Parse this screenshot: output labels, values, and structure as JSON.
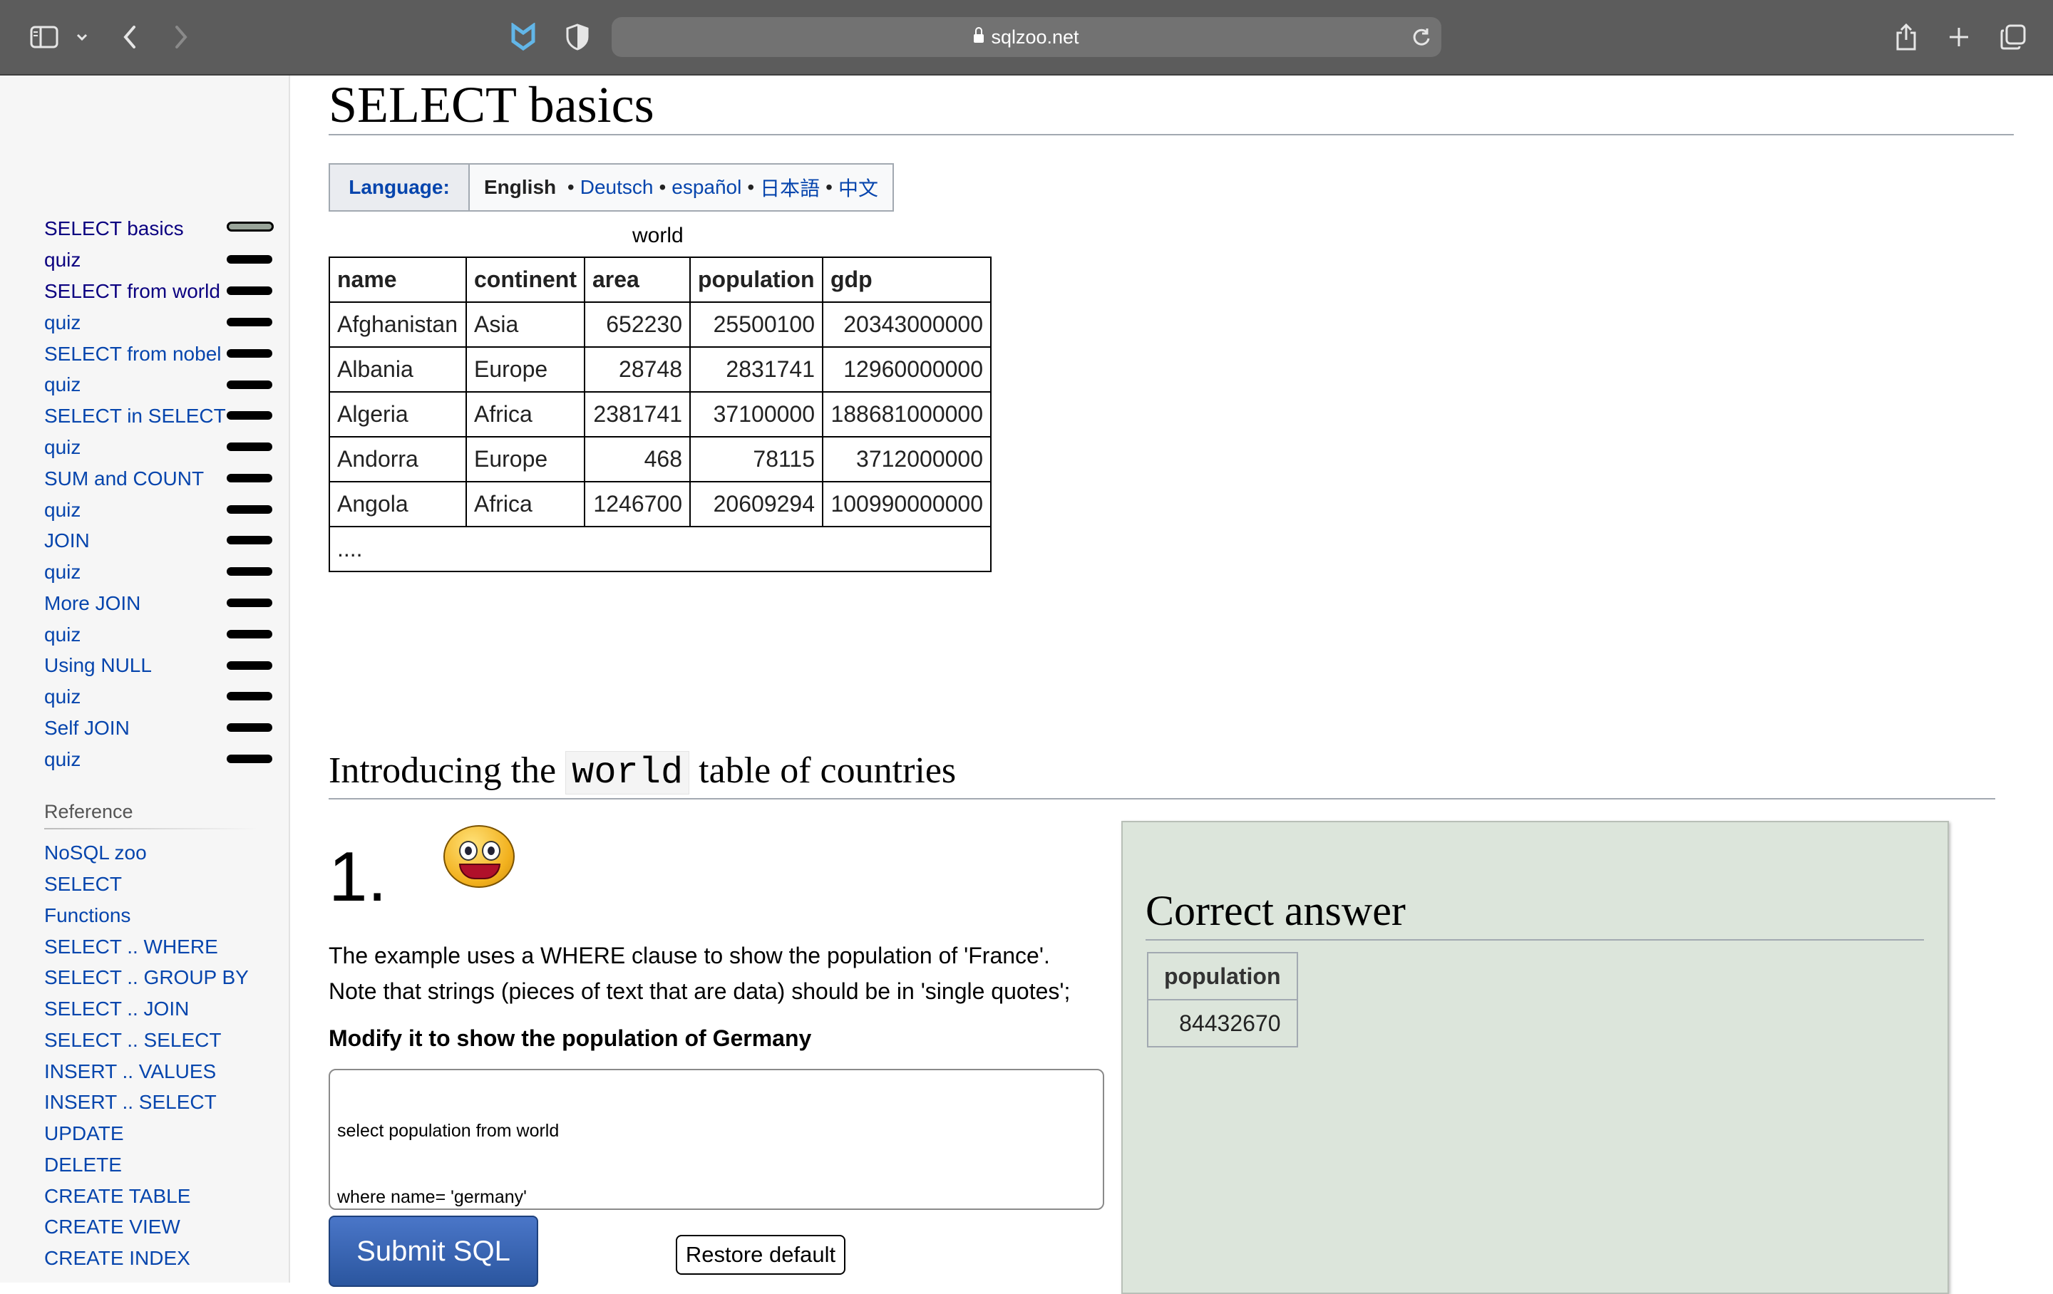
{
  "browser": {
    "url": "sqlzoo.net"
  },
  "sidebar": {
    "items": [
      {
        "label": "SELECT basics",
        "current": true
      },
      {
        "label": "quiz"
      },
      {
        "label": "SELECT from world"
      },
      {
        "label": "quiz"
      },
      {
        "label": "SELECT from nobel"
      },
      {
        "label": "quiz"
      },
      {
        "label": "SELECT in SELECT"
      },
      {
        "label": "quiz"
      },
      {
        "label": "SUM and COUNT"
      },
      {
        "label": "quiz"
      },
      {
        "label": "JOIN"
      },
      {
        "label": "quiz"
      },
      {
        "label": "More JOIN"
      },
      {
        "label": "quiz"
      },
      {
        "label": "Using NULL"
      },
      {
        "label": "quiz"
      },
      {
        "label": "Self JOIN"
      },
      {
        "label": "quiz"
      }
    ],
    "reference_heading": "Reference",
    "reference_items": [
      "NoSQL zoo",
      "SELECT",
      "Functions",
      "SELECT .. WHERE",
      "SELECT .. GROUP BY",
      "SELECT .. JOIN",
      "SELECT .. SELECT",
      "INSERT .. VALUES",
      "INSERT .. SELECT",
      "UPDATE",
      "DELETE",
      "CREATE TABLE",
      "CREATE VIEW",
      "CREATE INDEX"
    ]
  },
  "page": {
    "title": "SELECT basics",
    "language_label": "Language:",
    "languages": {
      "current": "English",
      "others": [
        "Deutsch",
        "español",
        "日本語",
        "中文"
      ]
    },
    "world_table": {
      "caption": "world",
      "headers": [
        "name",
        "continent",
        "area",
        "population",
        "gdp"
      ],
      "rows": [
        [
          "Afghanistan",
          "Asia",
          "652230",
          "25500100",
          "20343000000"
        ],
        [
          "Albania",
          "Europe",
          "28748",
          "2831741",
          "12960000000"
        ],
        [
          "Algeria",
          "Africa",
          "2381741",
          "37100000",
          "188681000000"
        ],
        [
          "Andorra",
          "Europe",
          "468",
          "78115",
          "3712000000"
        ],
        [
          "Angola",
          "Africa",
          "1246700",
          "20609294",
          "100990000000"
        ]
      ],
      "ellipsis": "...."
    },
    "section": {
      "title_before": "Introducing the",
      "title_code": "world",
      "title_after": "table of countries"
    },
    "question": {
      "number": "1.",
      "line1": "The example uses a WHERE clause to show the population of 'France'.",
      "line2": "Note that strings (pieces of text that are data) should be in 'single quotes';",
      "instruction": "Modify it to show the population of Germany",
      "sql_line1": "select population from world",
      "sql_line2": "where name= 'germany'",
      "submit_label": "Submit SQL",
      "restore_label": "Restore default"
    },
    "answer": {
      "title": "Correct answer",
      "header": "population",
      "value": "84432670"
    }
  },
  "colors": {
    "link": "#0645ad",
    "answer_bg": "#dce5db",
    "submit_bg": "#2b569f"
  }
}
